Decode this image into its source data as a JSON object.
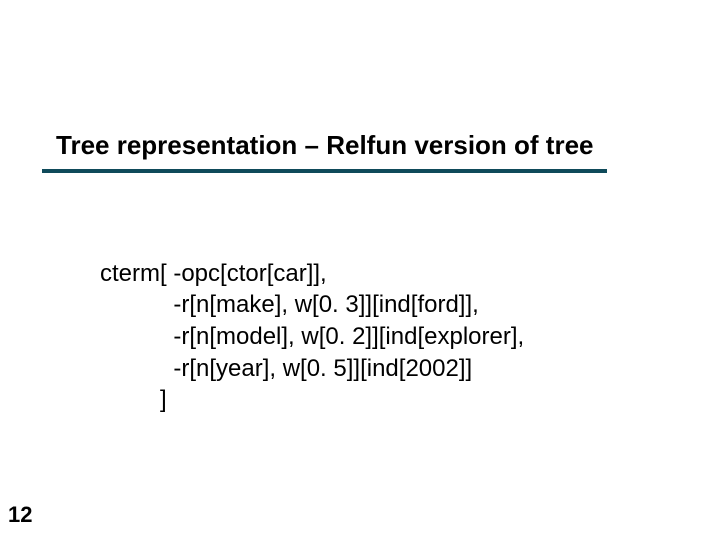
{
  "slide": {
    "title": "Tree representation – Relfun version of tree",
    "page_number": "12",
    "code_lines": [
      "cterm[ -opc[ctor[car]],",
      "           -r[n[make], w[0. 3]][ind[ford]],",
      "           -r[n[model], w[0. 2]][ind[explorer],",
      "           -r[n[year], w[0. 5]][ind[2002]]",
      "         ]"
    ]
  }
}
